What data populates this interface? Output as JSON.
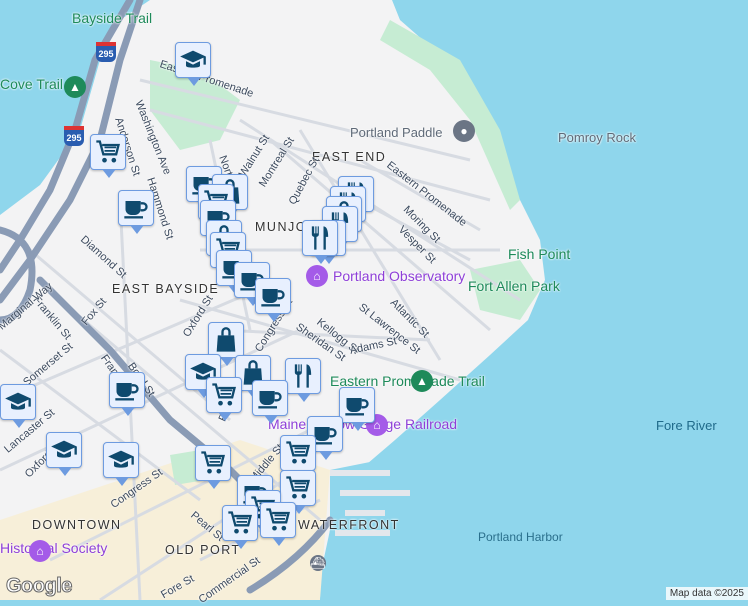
{
  "map": {
    "water_color": "#8fd6ec",
    "land_color": "#f3f3f4",
    "park_color": "#c6ecd3",
    "highway_color": "#8a9bb5",
    "marker_color": "#0f4a6e",
    "highway_shields": [
      "295",
      "295"
    ],
    "labels": [
      "Bayside Trail",
      "Cove Trail",
      "Washington Ave",
      "Anderson St",
      "Hammond St",
      "North St",
      "Walnut St",
      "Montreal St",
      "Eastern Promenade",
      "EAST END",
      "Quebec St",
      "Eastern Promenade",
      "Moring St",
      "Vesper St",
      "MUNJOY HILL",
      "Portland Observatory",
      "Portland Paddle",
      "Pomroy Rock",
      "Fish Point",
      "Fort Allen Park",
      "Atlantic St",
      "St Lawrence St",
      "Kellogg St",
      "Sheridan St",
      "Adams St",
      "Congress St",
      "Oxford St",
      "EAST BAYSIDE",
      "Diamond St",
      "Fox St",
      "Franklin St",
      "Marginal Way",
      "Somerset St",
      "Franklin St",
      "Boyd St",
      "Lancaster St",
      "Oxford St",
      "Congress St",
      "Federal St",
      "Middle St",
      "Pearl St",
      "DOWNTOWN",
      "OLD PORT",
      "Fore St",
      "Commercial St",
      "WATERFRONT",
      "Eastern Promenade Trail",
      "Maine Narrow Gauge Railroad",
      "Fore River",
      "Portland Harbor",
      "Historical Society"
    ],
    "markers": [
      "school",
      "cart",
      "cup",
      "cup",
      "bag",
      "cart",
      "cup",
      "bag",
      "cart",
      "cup",
      "cup",
      "restaurant",
      "restaurant",
      "bag",
      "restaurant",
      "restaurant",
      "restaurant",
      "cup",
      "bag",
      "school",
      "bag",
      "cart",
      "restaurant",
      "cup",
      "cup",
      "cup",
      "cart",
      "cart",
      "cart",
      "cup",
      "cart",
      "cart",
      "cart",
      "school",
      "school",
      "school",
      "cup"
    ]
  },
  "footer": {
    "google_logo": "Google",
    "attribution": "Map data ©2025"
  }
}
